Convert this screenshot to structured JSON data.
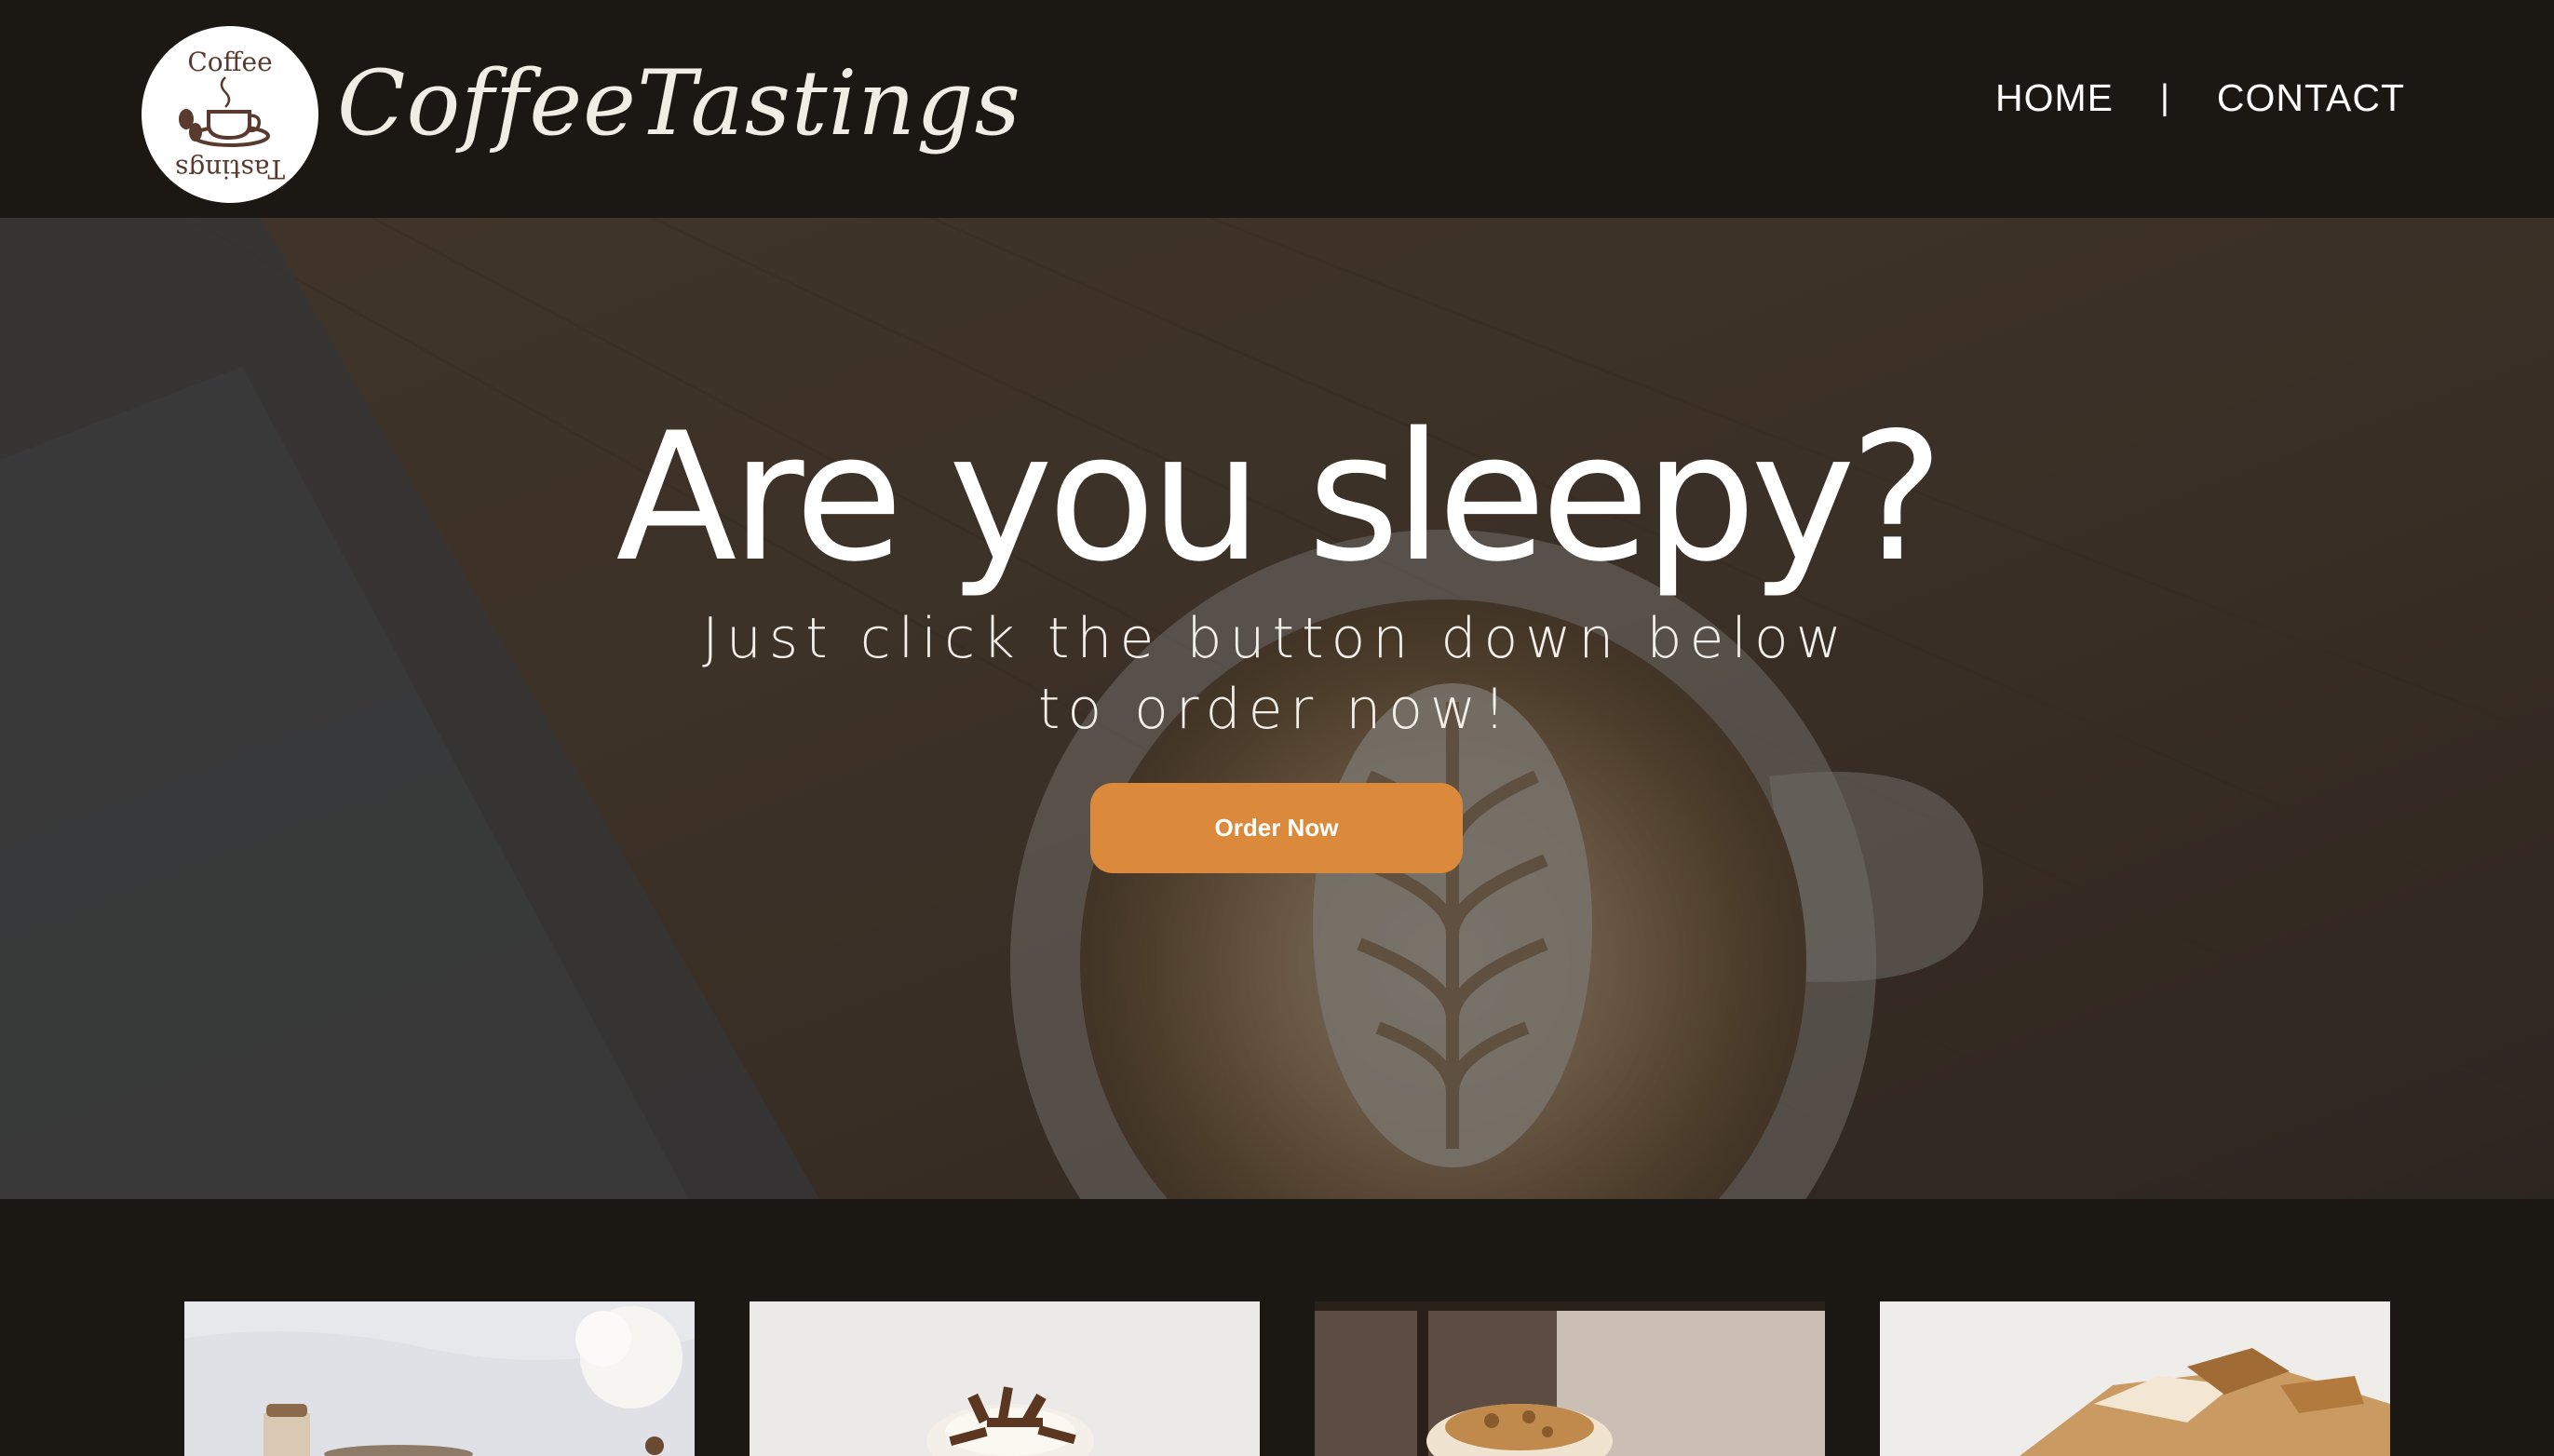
{
  "header": {
    "logo_badge_top": "Coffee",
    "logo_badge_bottom": "Tastings",
    "brand": "CoffeeTastings",
    "nav": [
      {
        "label": "HOME"
      },
      {
        "label": "CONTACT"
      }
    ],
    "nav_separator": "|"
  },
  "hero": {
    "title": "Are you sleepy?",
    "subtitle": "Just click the button down below to order now!",
    "cta_label": "Order Now"
  },
  "products": {
    "cards": [
      {
        "image": "dessert-cup-image"
      },
      {
        "image": "chocolate-drink-image"
      },
      {
        "image": "caramel-drink-image"
      },
      {
        "image": "biscoff-cake-image"
      }
    ]
  },
  "colors": {
    "header_bg": "#1b1713",
    "accent": "#db8a3b",
    "text_light": "#ffffff"
  }
}
